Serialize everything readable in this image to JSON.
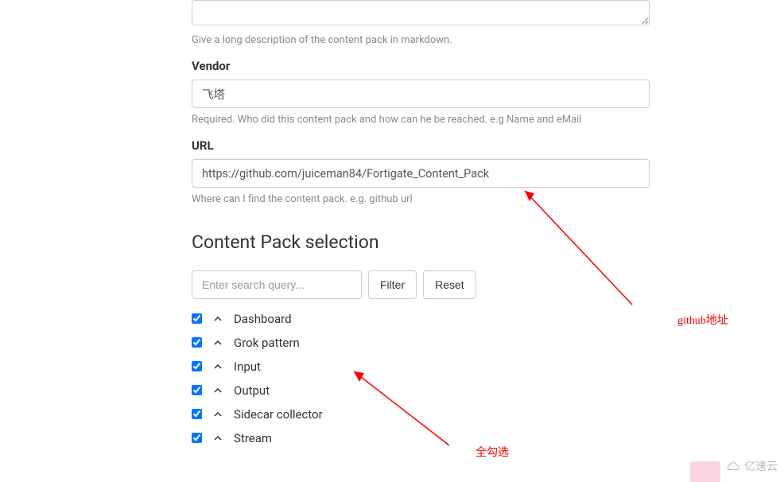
{
  "description": {
    "help": "Give a long description of the content pack in markdown."
  },
  "vendor": {
    "label": "Vendor",
    "value": "飞塔",
    "help": "Required. Who did this content pack and how can he be reached. e.g Name and eMail"
  },
  "url": {
    "label": "URL",
    "value": "https://github.com/juiceman84/Fortigate_Content_Pack",
    "help": "Where can I find the content pack. e.g. github url"
  },
  "selection": {
    "heading": "Content Pack selection",
    "search_placeholder": "Enter search query...",
    "filter_label": "Filter",
    "reset_label": "Reset",
    "items": [
      {
        "label": "Dashboard",
        "checked": true
      },
      {
        "label": "Grok pattern",
        "checked": true
      },
      {
        "label": "Input",
        "checked": true
      },
      {
        "label": "Output",
        "checked": true
      },
      {
        "label": "Sidecar collector",
        "checked": true
      },
      {
        "label": "Stream",
        "checked": true
      }
    ]
  },
  "annotations": {
    "github_addr": "github地址",
    "select_all": "全勾选"
  },
  "watermark": "亿速云"
}
